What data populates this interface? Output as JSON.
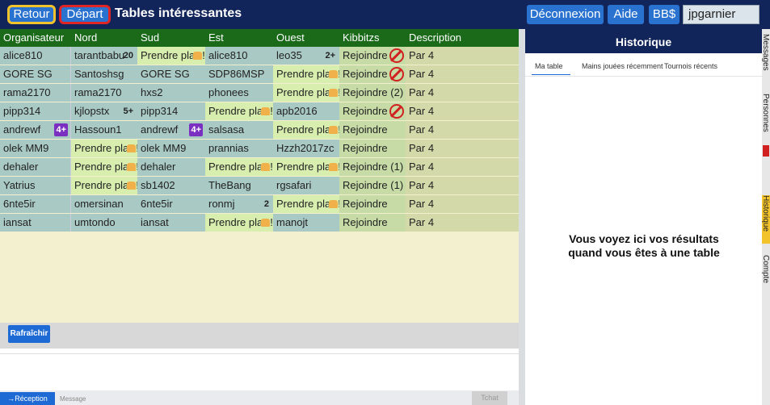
{
  "topbar": {
    "retour": "Retour",
    "depart": "Départ",
    "title": "Tables intéressantes",
    "deconnexion": "Déconnexion",
    "aide": "Aide",
    "bb": "BB$",
    "username": "jpgarnier"
  },
  "table": {
    "headers": [
      "Organisateur",
      "Nord",
      "Sud",
      "Est",
      "Ouest",
      "Kibbitzs",
      "Description"
    ],
    "rows": [
      {
        "org": "alice810",
        "n": "tarantbabu",
        "n_badge": "20",
        "s": "Prendre pla",
        "s_open": true,
        "e": "alice810",
        "o": "leo35",
        "o_badge": "2+",
        "k": "Rejoindre",
        "k_no": true,
        "d": "Par 4"
      },
      {
        "org": "GORE SG",
        "n": "Santoshsg",
        "s": "GORE SG",
        "e": "SDP86MSP",
        "o": "Prendre pla",
        "o_open": true,
        "k": "Rejoindre",
        "k_no": true,
        "d": "Par 4"
      },
      {
        "org": "rama2170",
        "n": "rama2170",
        "s": "hxs2",
        "e": "phonees",
        "o": "Prendre pla",
        "o_open": true,
        "k": "Rejoindre (2)",
        "d": "Par 4"
      },
      {
        "org": "pipp314",
        "n": "kjlopstx",
        "n_badge": "5+",
        "s": "pipp314",
        "e": "Prendre pla",
        "e_open": true,
        "o": "apb2016",
        "k": "Rejoindre",
        "k_no": true,
        "d": "Par 4"
      },
      {
        "org": "andrewf",
        "org_badge": "4+",
        "n": "Hassoun1",
        "s": "andrewf",
        "s_badge": "4+",
        "e": "salsasa",
        "o": "Prendre pla",
        "o_open": true,
        "k": "Rejoindre",
        "d": "Par 4"
      },
      {
        "org": "olek MM9",
        "n": "Prendre pla",
        "n_open": true,
        "s": "olek MM9",
        "e": "prannias",
        "o": "Hzzh2017zc",
        "k": "Rejoindre",
        "d": "Par 4"
      },
      {
        "org": "dehaler",
        "n": "Prendre pla",
        "n_open": true,
        "s": "dehaler",
        "e": "Prendre pla",
        "e_open": true,
        "o": "Prendre pla",
        "o_open": true,
        "k": "Rejoindre (1)",
        "d": "Par 4"
      },
      {
        "org": "Yatrius",
        "n": "Prendre pla",
        "n_open": true,
        "s": "sb1402",
        "e": "TheBang",
        "o": "rgsafari",
        "k": "Rejoindre (1)",
        "d": "Par 4"
      },
      {
        "org": "6nte5ir",
        "n": "omersinan",
        "s": "6nte5ir",
        "e": "ronmj",
        "e_badge": "2",
        "o": "Prendre pla",
        "o_open": true,
        "k": "Rejoindre",
        "d": "Par 4"
      },
      {
        "org": "iansat",
        "n": "umtondo",
        "s": "iansat",
        "e": "Prendre pla",
        "e_open": true,
        "o": "manojt",
        "k": "Rejoindre",
        "d": "Par 4"
      }
    ],
    "refresh": "Rafraîchir"
  },
  "chat": {
    "reception": "→Réception",
    "message_label": "Message",
    "tchat": "Tchat"
  },
  "panel": {
    "title": "Historique",
    "tabs": [
      "Ma table",
      "Mains jouées récemment",
      "Tournois récents"
    ],
    "empty_message": "Vous voyez ici vos résultats quand vous êtes à une table"
  },
  "side_tabs": [
    "Messages",
    "Personnes",
    "Historique",
    "Compte"
  ],
  "colors": {
    "topbar": "#12255a",
    "header_green": "#1a6a1a",
    "accent_blue": "#2a72d0"
  }
}
